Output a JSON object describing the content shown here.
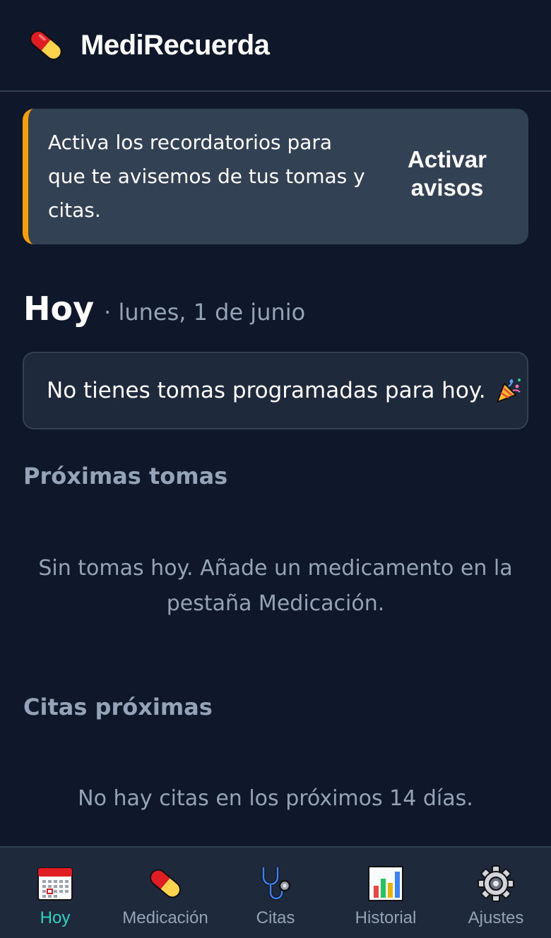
{
  "app": {
    "title": "MediRecuerda",
    "logo_icon": "pill-icon"
  },
  "banner": {
    "text": "Activa los recordatorios para que te avisemos de tus tomas y citas.",
    "button_label": "Activar avisos",
    "accent_color": "#f59e0b"
  },
  "today": {
    "title": "Hoy",
    "date": "· lunes, 1 de junio",
    "empty_message": "No tienes tomas programadas para hoy.",
    "empty_icon": "party-popper-icon"
  },
  "upcoming_doses": {
    "title": "Próximas tomas",
    "empty_message": "Sin tomas hoy. Añade un medicamento en la pestaña Medicación."
  },
  "appointments": {
    "title": "Citas próximas",
    "empty_message": "No hay citas en los próximos 14 días."
  },
  "nav": {
    "active_color": "#2dd4bf",
    "items": [
      {
        "label": "Hoy",
        "icon": "calendar-icon",
        "active": true
      },
      {
        "label": "Medicación",
        "icon": "pill-icon",
        "active": false
      },
      {
        "label": "Citas",
        "icon": "stethoscope-icon",
        "active": false
      },
      {
        "label": "Historial",
        "icon": "bar-chart-icon",
        "active": false
      },
      {
        "label": "Ajustes",
        "icon": "gear-icon",
        "active": false
      }
    ]
  }
}
